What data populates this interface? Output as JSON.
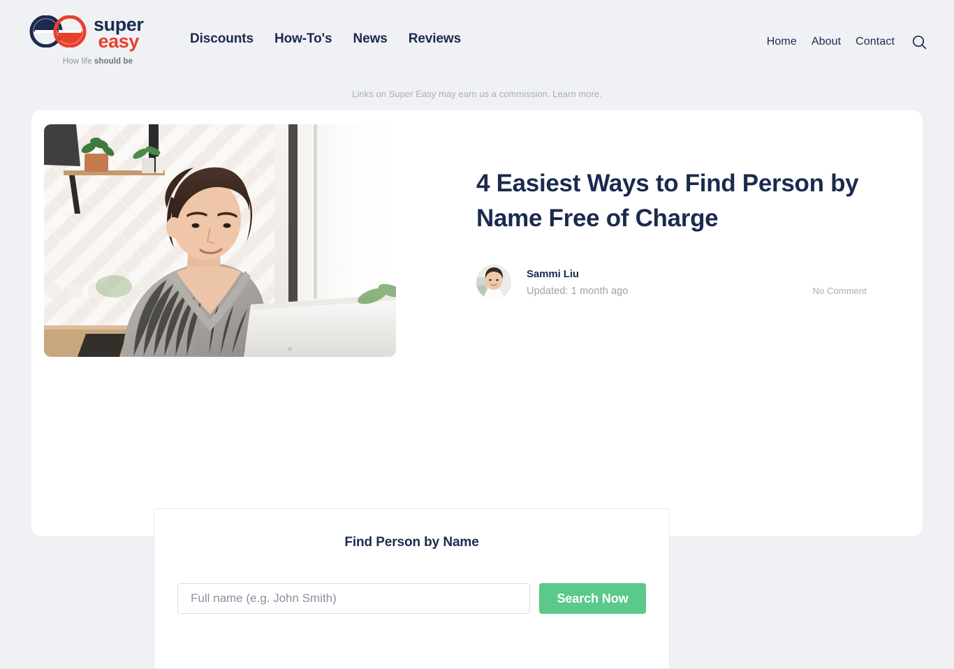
{
  "brand": {
    "name_line1": "super",
    "name_line2": "easy",
    "tagline_prefix": "How life ",
    "tagline_bold": "should be",
    "logo_icon": "double-circle-logo-icon",
    "navy": "#1b2a4e",
    "red": "#e8402a"
  },
  "nav": {
    "primary": [
      {
        "label": "Discounts"
      },
      {
        "label": "How-To's"
      },
      {
        "label": "News"
      },
      {
        "label": "Reviews"
      }
    ],
    "utility": [
      {
        "label": "Home"
      },
      {
        "label": "About"
      },
      {
        "label": "Contact"
      }
    ],
    "search_icon": "search-icon"
  },
  "disclaimer": {
    "text": "Links on Super Easy may earn us a commission.",
    "link_label": "Learn more."
  },
  "article": {
    "title": "4 Easiest Ways to Find Person by Name Free of Charge",
    "hero_image_alt": "Woman working on a laptop in a bright kitchen",
    "author": "Sammi Liu",
    "updated": "Updated: 1 month ago",
    "comments": "No Comment"
  },
  "widget": {
    "title": "Find Person by Name",
    "input_value": "",
    "input_placeholder": "Full name (e.g. John Smith)",
    "button_label": "Search Now",
    "button_color": "#5ac98a"
  }
}
